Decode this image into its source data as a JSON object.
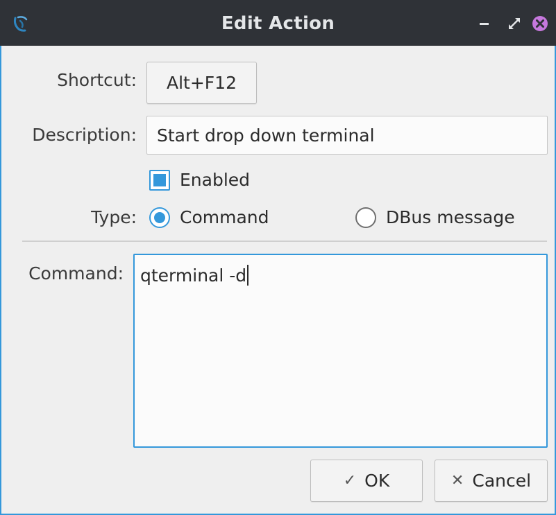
{
  "window": {
    "title": "Edit Action",
    "accent_color": "#3498db",
    "titlebar_color": "#2f3237",
    "close_color": "#c678dd"
  },
  "form": {
    "shortcut_label": "Shortcut:",
    "shortcut_value": "Alt+F12",
    "description_label": "Description:",
    "description_value": "Start drop down terminal",
    "enabled_label": "Enabled",
    "enabled_checked": true,
    "type_label": "Type:",
    "type_options": [
      "Command",
      "DBus message"
    ],
    "type_selected": "Command",
    "command_label": "Command:",
    "command_value": "qterminal -d"
  },
  "buttons": {
    "ok_label": "OK",
    "ok_icon": "check-icon",
    "cancel_label": "Cancel",
    "cancel_icon": "x-icon"
  }
}
